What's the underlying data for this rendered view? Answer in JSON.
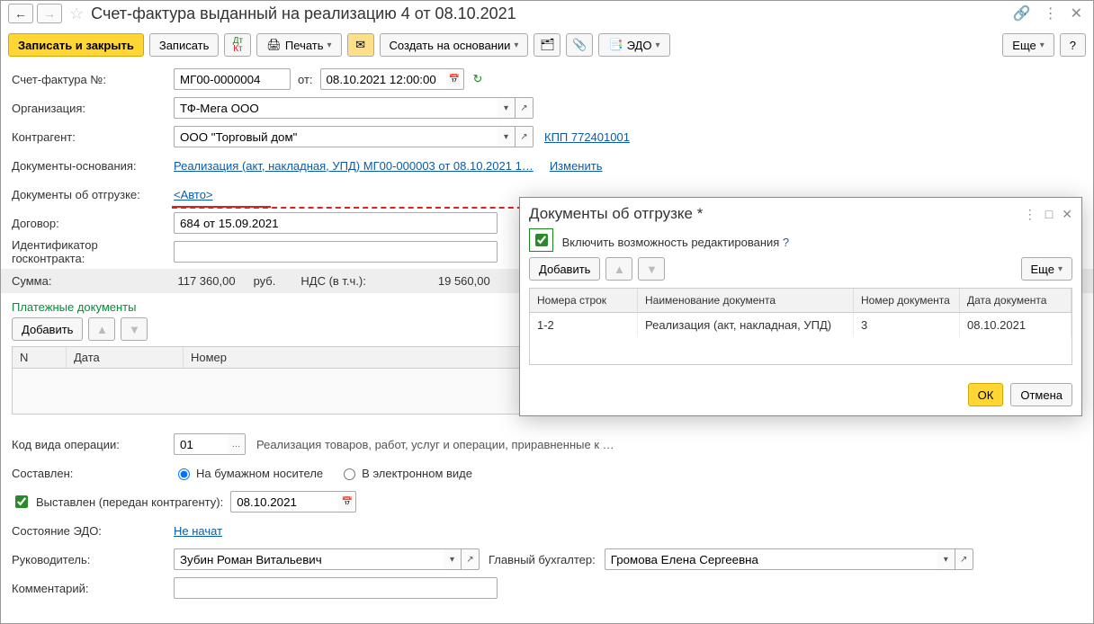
{
  "title": "Счет-фактура выданный на реализацию 4 от 08.10.2021",
  "toolbar": {
    "save_close": "Записать и закрыть",
    "save": "Записать",
    "print": "Печать",
    "create_based": "Создать на основании",
    "edo": "ЭДО",
    "more": "Еще"
  },
  "fields": {
    "number_lbl": "Счет-фактура №:",
    "number": "МГ00-0000004",
    "from_lbl": "от:",
    "date": "08.10.2021 12:00:00",
    "org_lbl": "Организация:",
    "org": "ТФ-Мега ООО",
    "contr_lbl": "Контрагент:",
    "contr": "ООО \"Торговый дом\"",
    "kpp": "КПП 772401001",
    "basis_lbl": "Документы-основания:",
    "basis_link": "Реализация (акт, накладная, УПД) МГ00-000003 от 08.10.2021 1…",
    "change": "Изменить",
    "ship_lbl": "Документы об отгрузке:",
    "ship_link": "<Авто>",
    "contract_lbl": "Договор:",
    "contract": "684 от 15.09.2021",
    "gov_id_lbl": "Идентификатор госконтракта:",
    "sum_lbl": "Сумма:",
    "sum": "117 360,00",
    "cur": "руб.",
    "vat_lbl": "НДС (в т.ч.):",
    "vat": "19 560,00",
    "pay_docs": "Платежные документы",
    "add": "Добавить",
    "col_n": "N",
    "col_date": "Дата",
    "col_num": "Номер",
    "op_code_lbl": "Код вида операции:",
    "op_code": "01",
    "op_desc": "Реализация товаров, работ, услуг и операции, приравненные к …",
    "composed_lbl": "Составлен:",
    "paper": "На бумажном носителе",
    "electr": "В электронном виде",
    "issued": "Выставлен (передан контрагенту):",
    "issued_date": "08.10.2021",
    "edo_state_lbl": "Состояние ЭДО:",
    "edo_state": "Не начат",
    "head_lbl": "Руководитель:",
    "head": "Зубин Роман Витальевич",
    "acc_lbl": "Главный бухгалтер:",
    "acc": "Громова Елена Сергеевна",
    "comment_lbl": "Комментарий:"
  },
  "popup": {
    "title": "Документы об отгрузке *",
    "enable_edit": "Включить возможность редактирования",
    "add": "Добавить",
    "more": "Еще",
    "cols": {
      "lines": "Номера строк",
      "name": "Наименование документа",
      "num": "Номер документа",
      "date": "Дата документа"
    },
    "row": {
      "lines": "1-2",
      "name": "Реализация (акт, накладная, УПД)",
      "num": "3",
      "date": "08.10.2021"
    },
    "ok": "ОК",
    "cancel": "Отмена"
  }
}
